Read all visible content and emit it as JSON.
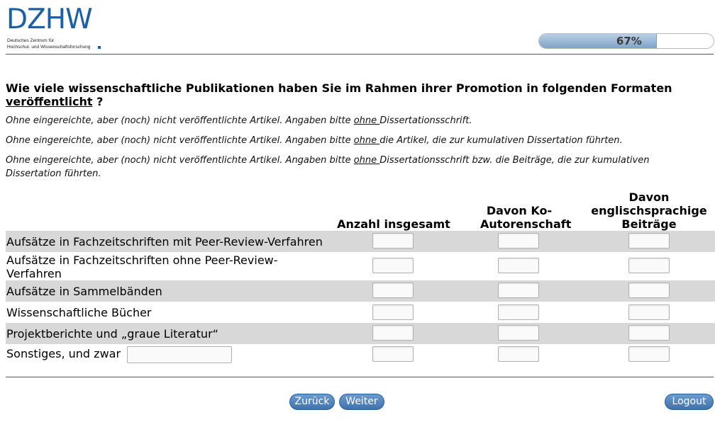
{
  "logo": {
    "wordmark": "DZHW",
    "line1": "Deutsches Zentrum für",
    "line2": "Hochschul- und Wissenschaftsforschung",
    "brand_color": "#1b5fa8"
  },
  "progress": {
    "percent": 67,
    "label": "67%"
  },
  "question": {
    "text": "Wie viele wissenschaftliche Publikationen haben Sie im Rahmen ihrer Promotion in folgenden Formaten ",
    "emphasis": "veröffentlicht",
    "suffix": " ?"
  },
  "notes": [
    {
      "before": "Ohne eingereichte, aber (noch) nicht veröffentlichte Artikel. Angaben bitte ",
      "underlined": "ohne ",
      "after": "Dissertationsschrift."
    },
    {
      "before": "Ohne eingereichte, aber (noch) nicht veröffentlichte Artikel. Angaben bitte ",
      "underlined": "ohne ",
      "after": "die Artikel, die zur kumulativen Dissertation führten."
    },
    {
      "before": "Ohne eingereichte, aber (noch) nicht veröffentlichte Artikel. Angaben bitte ",
      "underlined": "ohne ",
      "after": "Dissertationsschrift bzw. die Beiträge, die zur kumulativen Dissertation führten."
    }
  ],
  "table": {
    "columns": [
      "Anzahl insgesamt",
      "Davon Ko-Autorenschaft",
      "Davon englischsprachige Beiträge"
    ],
    "rows": [
      {
        "label": "Aufsätze in Fachzeitschriften mit Peer-Review-Verfahren",
        "values": [
          "",
          "",
          ""
        ]
      },
      {
        "label": "Aufsätze in Fachzeitschriften ohne Peer-Review-Verfahren",
        "values": [
          "",
          "",
          ""
        ]
      },
      {
        "label": "Aufsätze in Sammelbänden",
        "values": [
          "",
          "",
          ""
        ]
      },
      {
        "label": "Wissenschaftliche Bücher",
        "values": [
          "",
          "",
          ""
        ]
      },
      {
        "label": "Projektberichte und „graue Literatur“",
        "values": [
          "",
          "",
          ""
        ]
      },
      {
        "label": "Sonstiges, und zwar",
        "other_value": "",
        "values": [
          "",
          "",
          ""
        ]
      }
    ]
  },
  "buttons": {
    "back": "Zurück",
    "next": "Weiter",
    "logout": "Logout"
  }
}
